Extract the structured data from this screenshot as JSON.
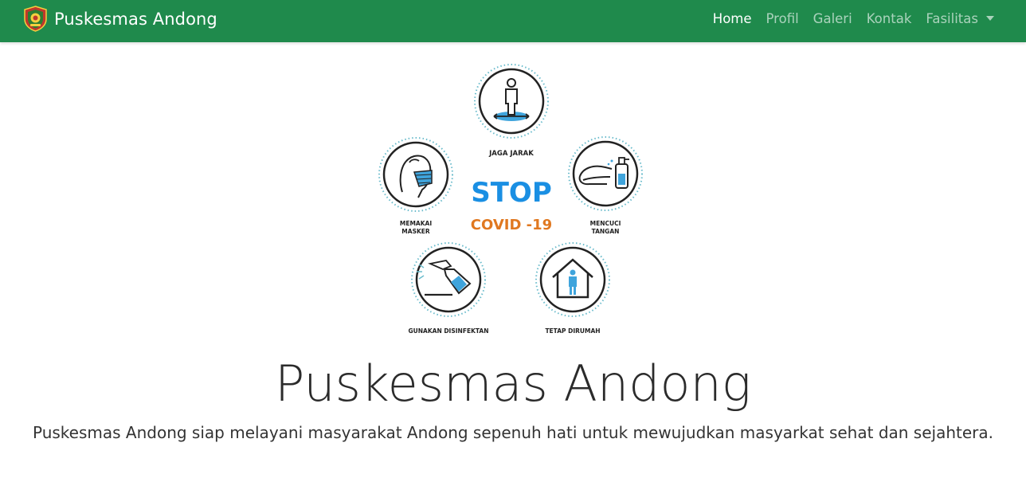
{
  "navbar": {
    "brand": {
      "text": "Puskesmas Andong",
      "logo_icon": "regency-emblem-icon"
    },
    "links": [
      {
        "label": "Home",
        "active": true
      },
      {
        "label": "Profil",
        "active": false
      },
      {
        "label": "Galeri",
        "active": false
      },
      {
        "label": "Kontak",
        "active": false
      },
      {
        "label": "Fasilitas",
        "active": false,
        "dropdown": true
      }
    ],
    "background_color": "#1f8a4c"
  },
  "hero_graphic": {
    "headline": "STOP",
    "subheadline": "COVID -19",
    "headline_color": "#1a8fe3",
    "subheadline_color": "#e07820",
    "items": [
      {
        "icon": "person-distance-icon",
        "label_lines": [
          "JAGA JARAK"
        ]
      },
      {
        "icon": "face-mask-icon",
        "label_lines": [
          "MEMAKAI",
          "MASKER"
        ]
      },
      {
        "icon": "hand-wash-icon",
        "label_lines": [
          "MENCUCI",
          "TANGAN"
        ]
      },
      {
        "icon": "disinfectant-spray-icon",
        "label_lines": [
          "GUNAKAN DISINFEKTAN"
        ]
      },
      {
        "icon": "stay-home-icon",
        "label_lines": [
          "TETAP DIRUMAH"
        ]
      }
    ]
  },
  "main": {
    "title": "Puskesmas Andong",
    "lead": "Puskesmas Andong siap melayani masyarakat Andong sepenuh hati untuk mewujudkan masyarkat sehat dan sejahtera."
  }
}
